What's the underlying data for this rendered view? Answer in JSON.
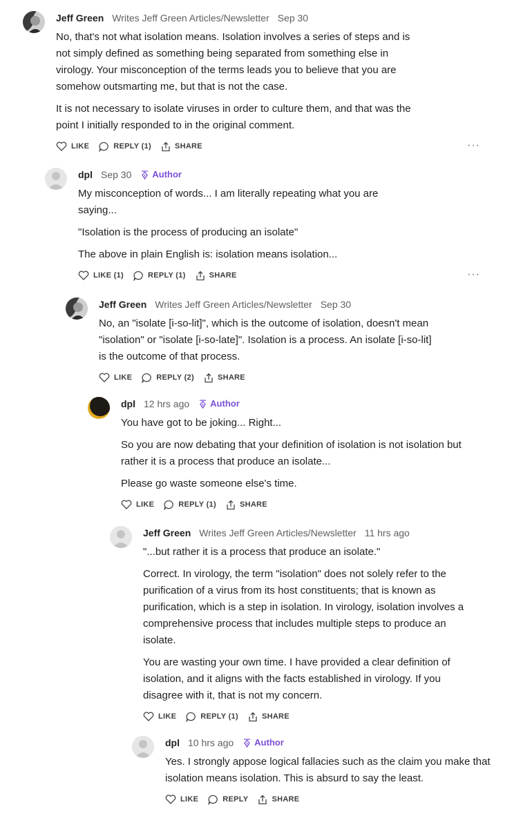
{
  "labels": {
    "like": "LIKE",
    "reply": "REPLY",
    "share": "SHARE",
    "author_badge": "Author",
    "more": "···"
  },
  "comments": [
    {
      "author": "Jeff Green",
      "writes": "Writes Jeff Green Articles/Newsletter",
      "date": "Sep 30",
      "paragraphs": [
        "No, that's not what isolation means. Isolation involves a series of steps and is not simply defined as something being separated from something else in virology. Your misconception of the terms leads you to believe that you are somehow outsmarting me, but that is not the case.",
        "It is not necessary to isolate viruses in order to culture them, and that was the point I initially responded to in the original comment."
      ],
      "like": "LIKE",
      "reply": "REPLY (1)",
      "share": "SHARE"
    },
    {
      "author": "dpl",
      "date": "Sep 30",
      "badge": "Author",
      "paragraphs": [
        "My misconception of words... I am literally repeating what you are saying...",
        "\"Isolation is the process of producing an isolate\"",
        "The above in plain English is: isolation means isolation..."
      ],
      "like": "LIKE (1)",
      "reply": "REPLY (1)",
      "share": "SHARE"
    },
    {
      "author": "Jeff Green",
      "writes": "Writes Jeff Green Articles/Newsletter",
      "date": "Sep 30",
      "paragraphs": [
        "No, an \"isolate [i-so-lit]\", which is the outcome of isolation, doesn't mean \"isolation\" or \"isolate [i-so-late]\". Isolation is a process. An isolate [i-so-lit] is the outcome of that process."
      ],
      "like": "LIKE",
      "reply": "REPLY (2)",
      "share": "SHARE"
    },
    {
      "author": "dpl",
      "date": "12 hrs ago",
      "badge": "Author",
      "paragraphs": [
        "You have got to be joking... Right...",
        "So you are now debating that your definition of isolation is not isolation but rather it is a process that produce an isolate...",
        "Please go waste someone else's time."
      ],
      "like": "LIKE",
      "reply": "REPLY (1)",
      "share": "SHARE"
    },
    {
      "author": "Jeff Green",
      "writes": "Writes Jeff Green Articles/Newsletter",
      "date": "11 hrs ago",
      "paragraphs": [
        "\"...but rather it is a process that produce an isolate.\"",
        "Correct. In virology, the term \"isolation\" does not solely refer to the purification of a virus from its host constituents; that is known as purification, which is a step in isolation. In virology, isolation involves a comprehensive process that includes multiple steps to produce an isolate.",
        "You are wasting your own time. I have provided a clear definition of isolation, and it aligns with the facts established in virology. If you disagree with it, that is not my concern."
      ],
      "like": "LIKE",
      "reply": "REPLY (1)",
      "share": "SHARE"
    },
    {
      "author": "dpl",
      "date": "10 hrs ago",
      "badge": "Author",
      "paragraphs": [
        "Yes. I strongly appose logical fallacies such as the claim you make that isolation means isolation. This is absurd to say the least."
      ],
      "like": "LIKE",
      "reply": "REPLY",
      "share": "SHARE"
    }
  ]
}
